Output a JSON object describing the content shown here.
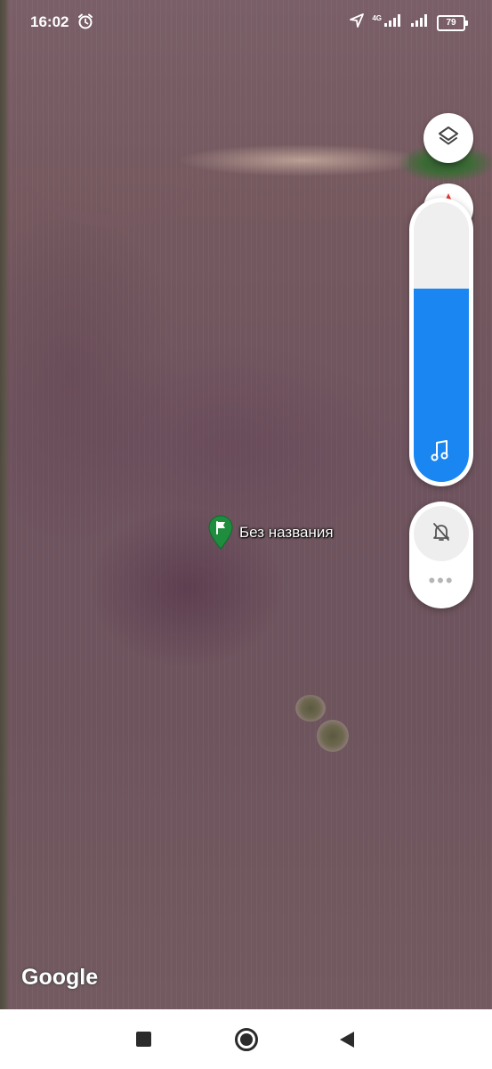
{
  "status_bar": {
    "time": "16:02",
    "network_label": "4G",
    "battery_level": "79"
  },
  "map": {
    "marker_label": "Без названия",
    "attribution": "Google"
  },
  "controls": {
    "layers_icon": "layers-icon",
    "compass_icon": "compass-icon"
  },
  "volume_panel": {
    "level_fraction": 0.69,
    "icon": "music-note-icon",
    "ring_icon": "bell-off-icon",
    "more_icon": "more-dots-icon",
    "fill_color": "#1a86f2"
  },
  "nav_bar": {
    "recents_icon": "square-icon",
    "home_icon": "circle-icon",
    "back_icon": "back-triangle-icon"
  }
}
